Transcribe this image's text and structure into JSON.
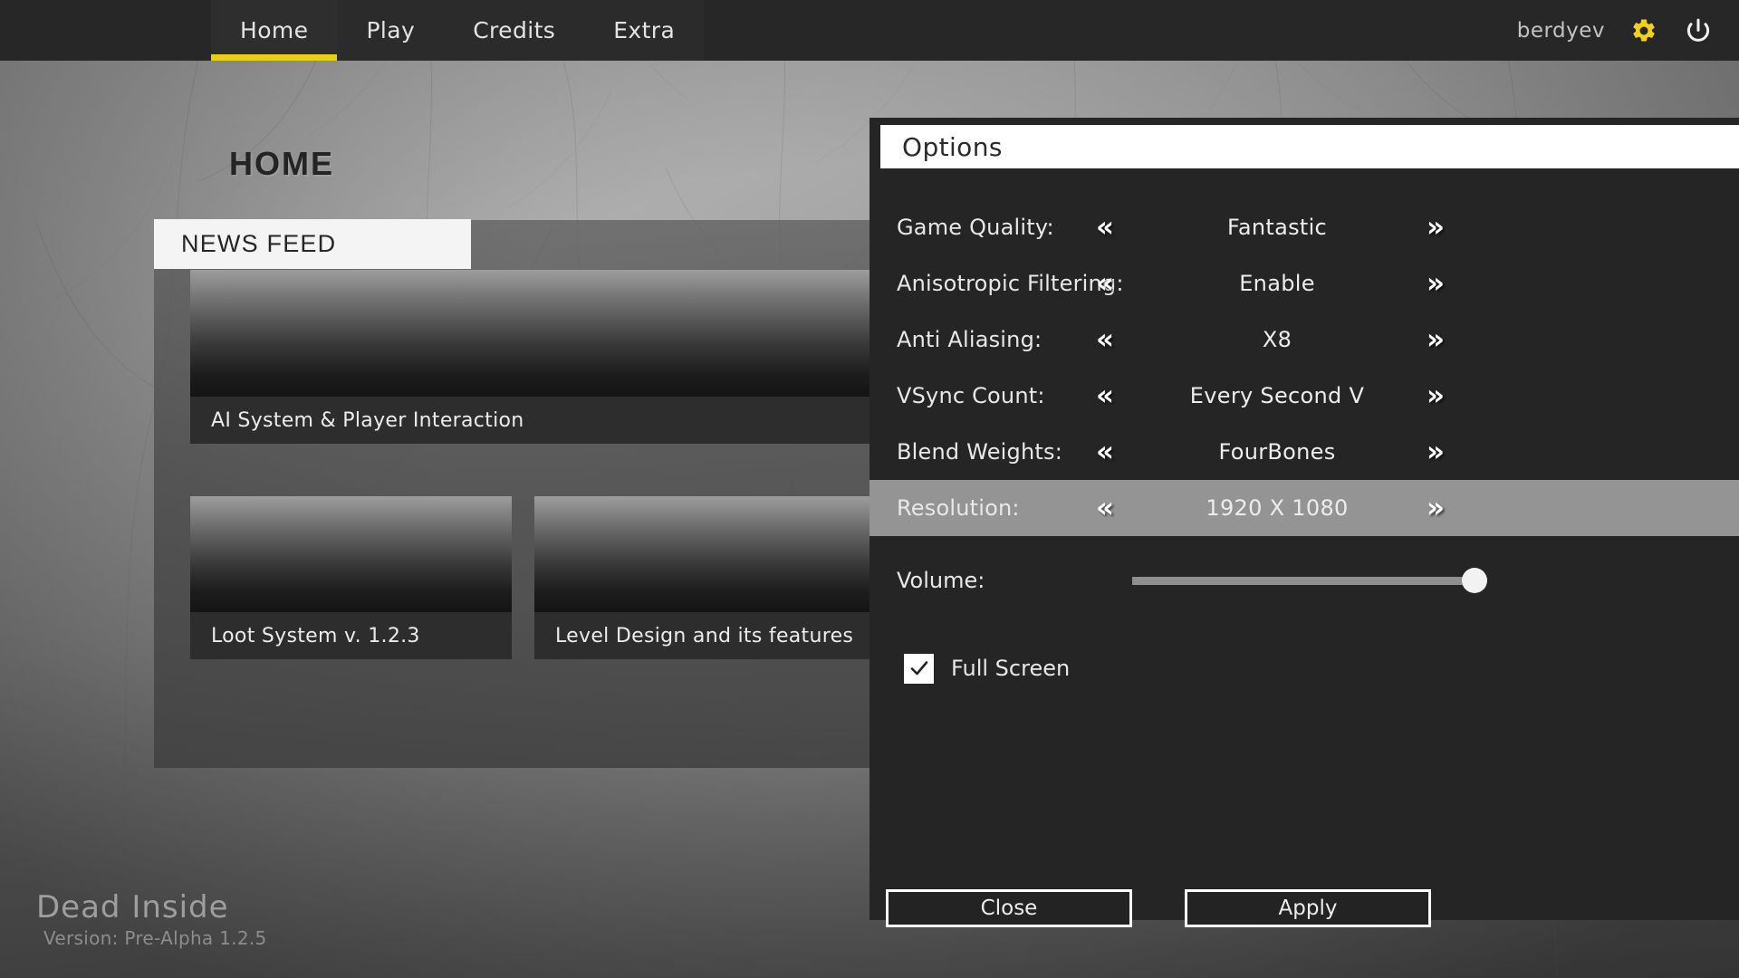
{
  "theme": {
    "accent": "#e8ce16",
    "panel_bg": "#252525",
    "topbar_bg": "#272727",
    "selected_row": "#949494",
    "text_light": "#ededed"
  },
  "topbar": {
    "tabs": [
      {
        "label": "Home",
        "active": true
      },
      {
        "label": "Play",
        "active": false
      },
      {
        "label": "Credits",
        "active": false
      },
      {
        "label": "Extra",
        "active": false
      }
    ],
    "username": "berdyev",
    "settings_icon": "gear-icon",
    "power_icon": "power-icon"
  },
  "page": {
    "title": "HOME"
  },
  "newsfeed": {
    "header": "NEWS FEED",
    "cards": [
      {
        "caption": "AI System & Player Interaction"
      },
      {
        "caption": "Loot System v. 1.2.3"
      },
      {
        "caption": "Level Design and its features"
      }
    ]
  },
  "brand": {
    "title": "Dead Inside",
    "version": "Version: Pre-Alpha 1.2.5"
  },
  "options": {
    "title": "Options",
    "arrow_left": "«",
    "arrow_right": "»",
    "rows": [
      {
        "label": "Game Quality:",
        "value": "Fantastic",
        "selected": false
      },
      {
        "label": "Anisotropic Filtering:",
        "value": "Enable",
        "selected": false
      },
      {
        "label": "Anti Aliasing:",
        "value": "X8",
        "selected": false
      },
      {
        "label": "VSync Count:",
        "value": "Every Second V",
        "selected": false
      },
      {
        "label": "Blend Weights:",
        "value": "FourBones",
        "selected": false
      },
      {
        "label": "Resolution:",
        "value": "1920 X 1080",
        "selected": true
      }
    ],
    "volume": {
      "label": "Volume:",
      "percent": 100
    },
    "fullscreen": {
      "label": "Full Screen",
      "checked": true,
      "icon": "check-icon"
    },
    "buttons": {
      "close": "Close",
      "apply": "Apply"
    }
  }
}
